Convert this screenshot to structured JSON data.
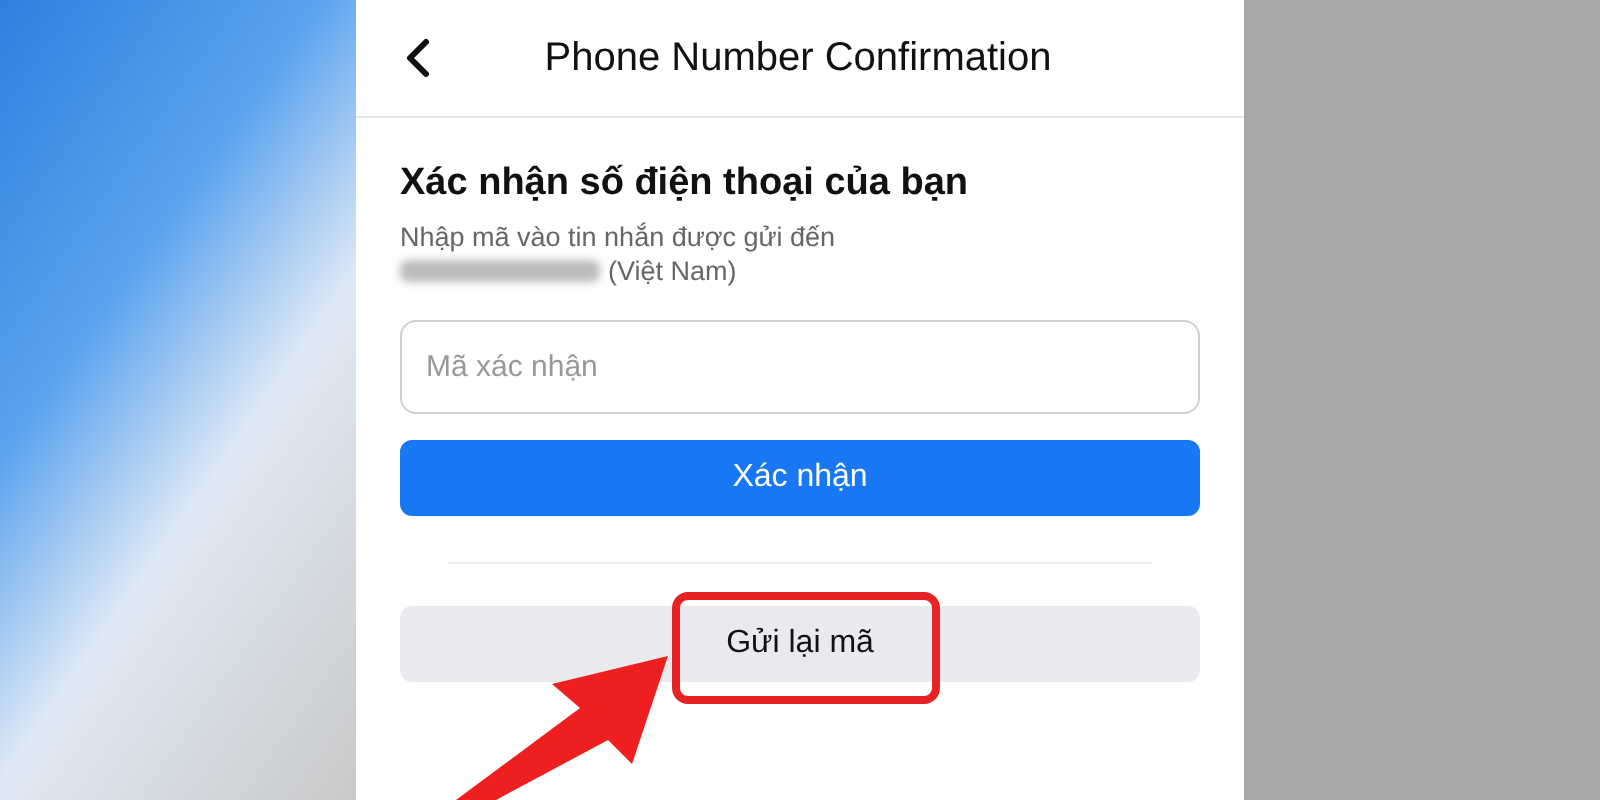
{
  "header": {
    "title": "Phone Number Confirmation"
  },
  "heading": "Xác nhận số điện thoại của bạn",
  "instructions": "Nhập mã vào tin nhắn được gửi đến",
  "country": "(Việt Nam)",
  "code_field": {
    "placeholder": "Mã xác nhận"
  },
  "confirm_button": "Xác nhận",
  "resend_button": "Gửi lại mã"
}
